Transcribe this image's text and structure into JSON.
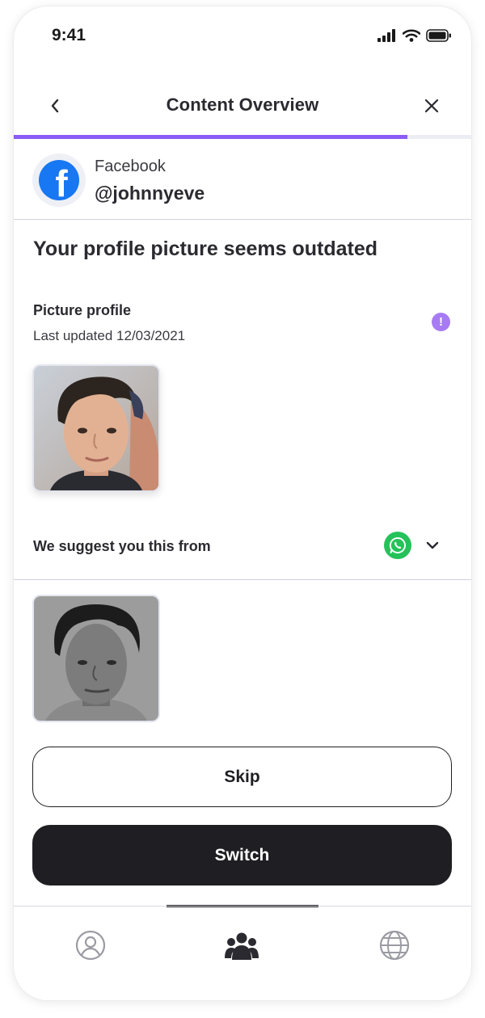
{
  "status_bar": {
    "time": "9:41"
  },
  "header": {
    "title": "Content Overview",
    "progress_percent": 86
  },
  "account": {
    "platform": "Facebook",
    "handle": "@johnnyeve"
  },
  "headline": "Your profile picture seems outdated",
  "current_picture": {
    "label": "Picture profile",
    "last_updated": "Last updated 12/03/2021"
  },
  "suggestion": {
    "label": "We suggest you this from",
    "source_icon": "whatsapp-icon"
  },
  "actions": {
    "skip_label": "Skip",
    "switch_label": "Switch"
  },
  "tabbar": {
    "tabs": [
      "profile-icon",
      "community-icon",
      "globe-icon"
    ],
    "active": "community-icon"
  },
  "colors": {
    "accent": "#8b5cf6",
    "facebook": "#1877f2",
    "whatsapp": "#25c25a",
    "primary_button": "#1f1f23"
  }
}
